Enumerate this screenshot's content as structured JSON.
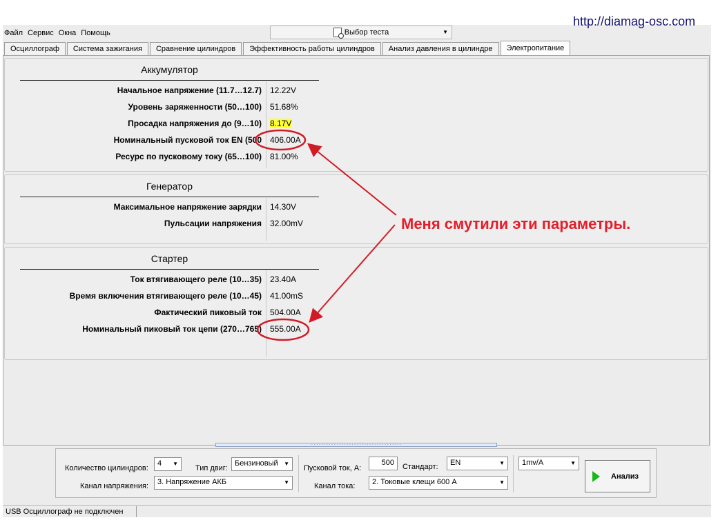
{
  "watermark_url": "http://diamag-osc.com",
  "menu": [
    "Файл",
    "Сервис",
    "Окна",
    "Помощь"
  ],
  "test_selector": {
    "label": "Выбор теста",
    "icon": "document-search-icon"
  },
  "tabs": [
    "Осциллограф",
    "Система зажигания",
    "Сравнение цилиндров",
    "Эффективность работы цилиндров",
    "Анализ давления в цилиндре",
    "Электропитание"
  ],
  "active_tab": "Электропитание",
  "sections": {
    "battery": {
      "title": "Аккумулятор",
      "rows": [
        {
          "label": "Начальное напряжение (11.7…12.7)",
          "value": "12.22V"
        },
        {
          "label": "Уровень заряженности (50…100)",
          "value": "51.68%"
        },
        {
          "label": "Просадка напряжения до (9…10)",
          "value": "8.17V",
          "highlight": "#ffff33"
        },
        {
          "label": "Номинальный пусковой ток EN (500",
          "value": "406.00A",
          "circled": true
        },
        {
          "label": "Ресурс по пусковому току (65…100)",
          "value": "81.00%"
        }
      ]
    },
    "generator": {
      "title": "Генератор",
      "rows": [
        {
          "label": "Максимальное напряжение зарядки",
          "value": "14.30V"
        },
        {
          "label": "Пульсации напряжения",
          "value": "32.00mV"
        }
      ]
    },
    "starter": {
      "title": "Стартер",
      "rows": [
        {
          "label": "Ток втягивающего реле (10…35)",
          "value": "23.40A"
        },
        {
          "label": "Время включения втягивающего реле (10…45)",
          "value": "41.00mS"
        },
        {
          "label": "Фактический пиковый ток",
          "value": "504.00A"
        },
        {
          "label": "Номинальный пиковый ток цепи (270…765)",
          "value": "555.00A",
          "circled": true
        }
      ]
    }
  },
  "annotation": {
    "text": "Меня смутили эти параметры.",
    "color": "#e41e2a"
  },
  "settings": {
    "cylinders_label": "Количество цилиндров:",
    "cylinders_value": "4",
    "engine_type_label": "Тип двиг:",
    "engine_type_value": "Бензиновый",
    "voltage_channel_label": "Канал напряжения:",
    "voltage_channel_value": "3.  Напряжение АКБ",
    "starting_current_label": "Пусковой ток, А:",
    "starting_current_value": "500",
    "standard_label": "Стандарт:",
    "standard_value": "EN",
    "current_channel_label": "Канал тока:",
    "current_channel_value": "2.  Токовые клещи 600 А",
    "sensitivity_value": "1mv/A",
    "analyze_label": "Анализ"
  },
  "status": {
    "connection": "USB Осциллограф не подключен"
  }
}
